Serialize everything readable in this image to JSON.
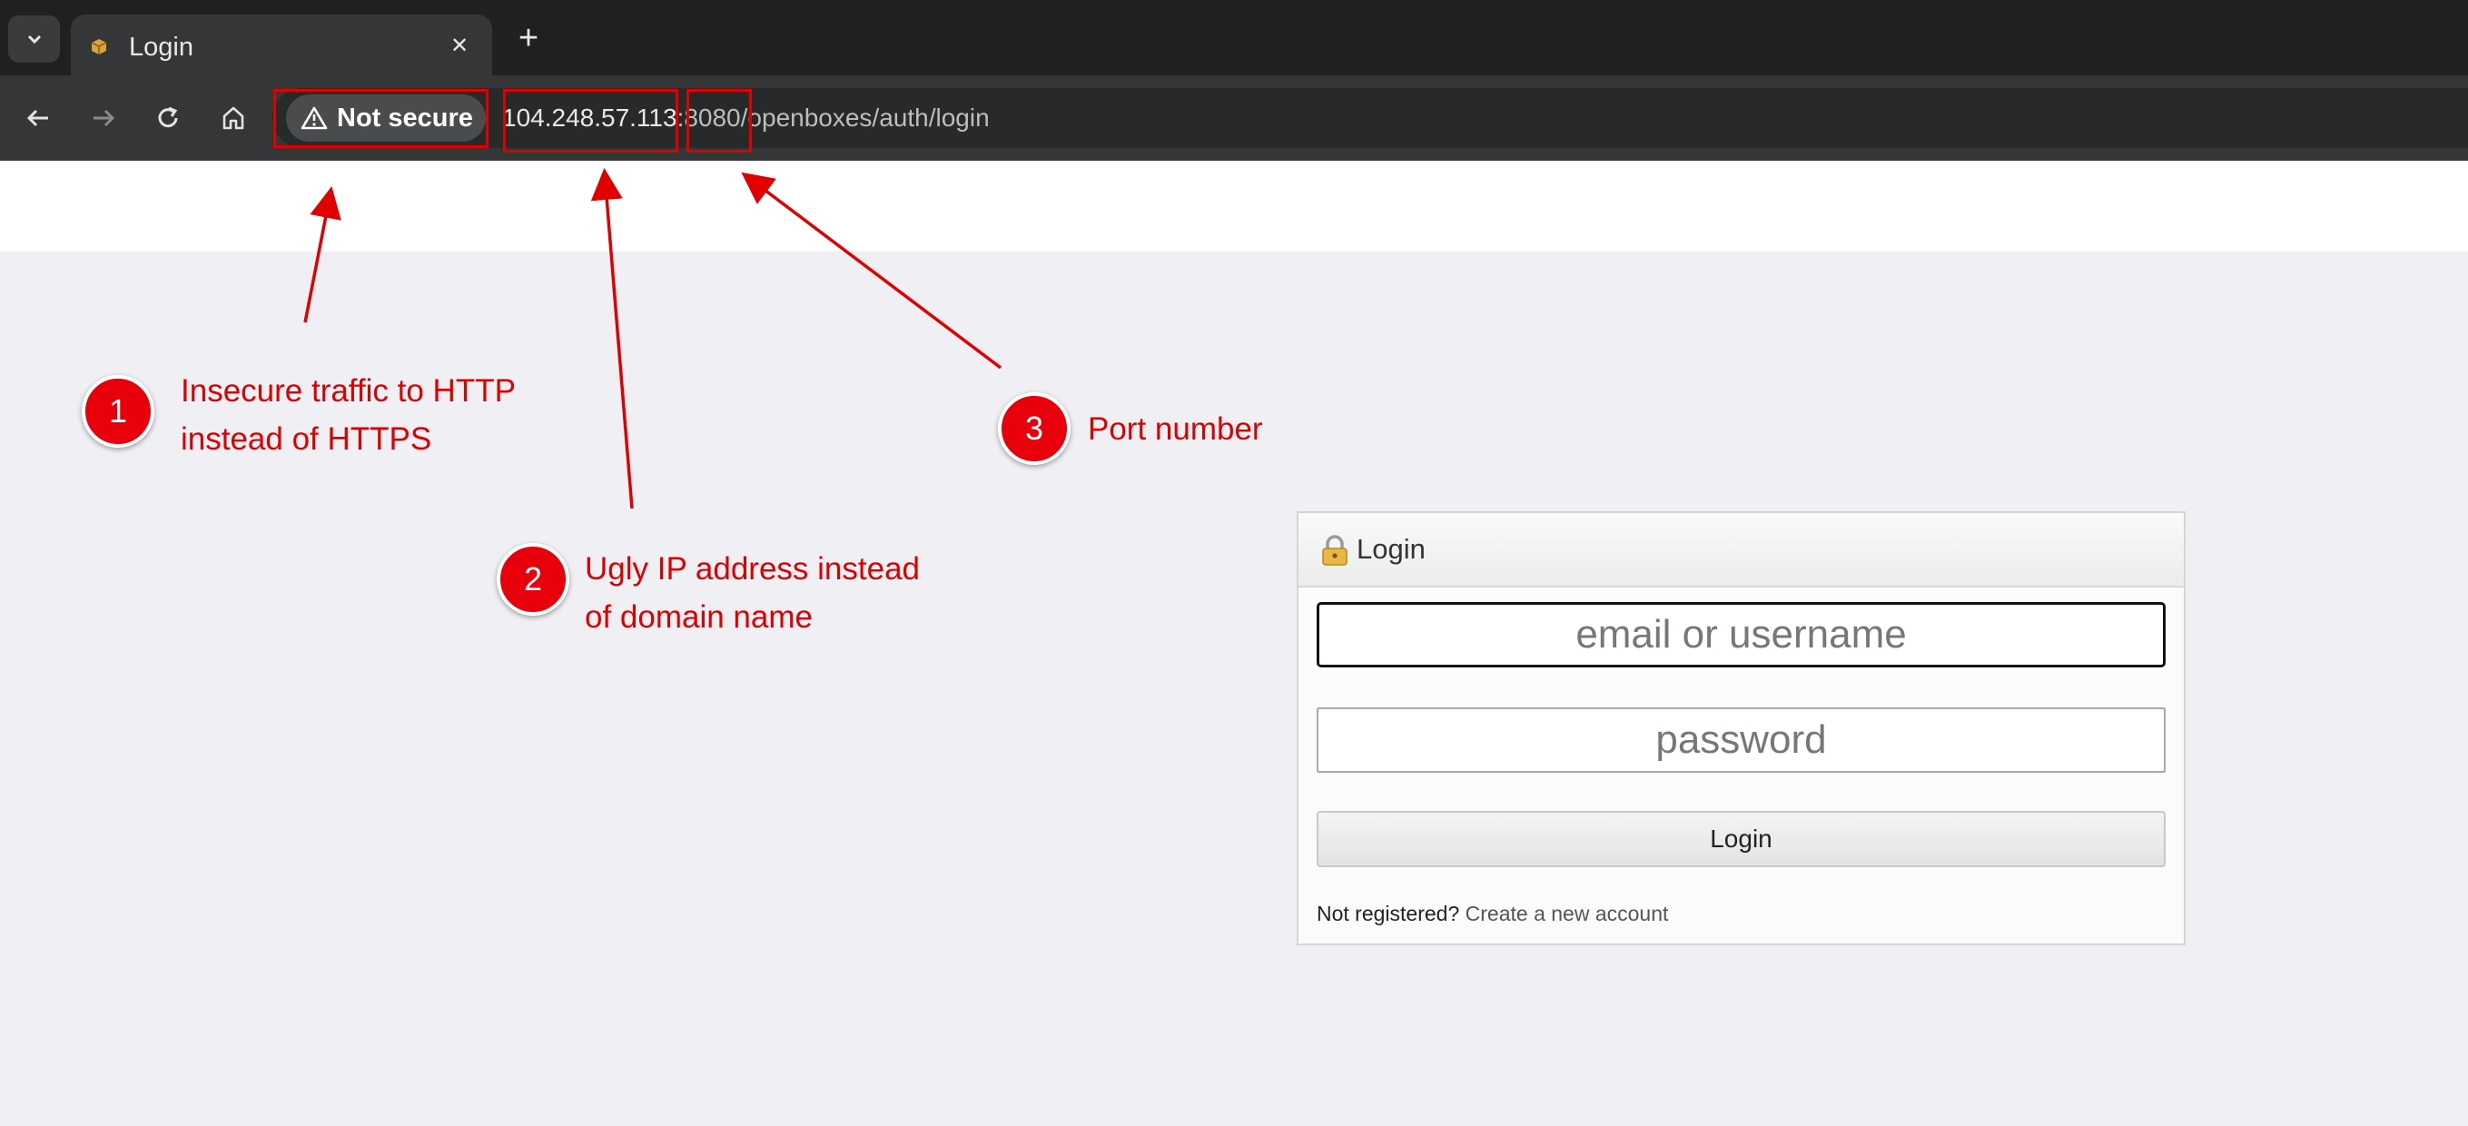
{
  "browser": {
    "tab_title": "Login",
    "tab_close_symbol": "✕",
    "new_tab_symbol": "+",
    "security_label": "Not secure",
    "url_host": "104.248.57.113",
    "url_colon": ":",
    "url_port": "8080",
    "url_path": "/openboxes/auth/login"
  },
  "login": {
    "header": "Login",
    "username_placeholder": "email or username",
    "password_placeholder": "password",
    "submit_label": "Login",
    "register_prompt": "Not registered?",
    "register_link": "Create a new account"
  },
  "annotations": [
    {
      "number": "1",
      "line1": "Insecure traffic to HTTP",
      "line2": "instead of HTTPS"
    },
    {
      "number": "2",
      "line1": "Ugly IP address instead",
      "line2": "of domain name"
    },
    {
      "number": "3",
      "line1": "Port number",
      "line2": ""
    }
  ],
  "colors": {
    "annotation_red": "#e00000",
    "chrome_dark": "#1f2021",
    "toolbar": "#353638",
    "page_bg": "#f0f0f4"
  }
}
